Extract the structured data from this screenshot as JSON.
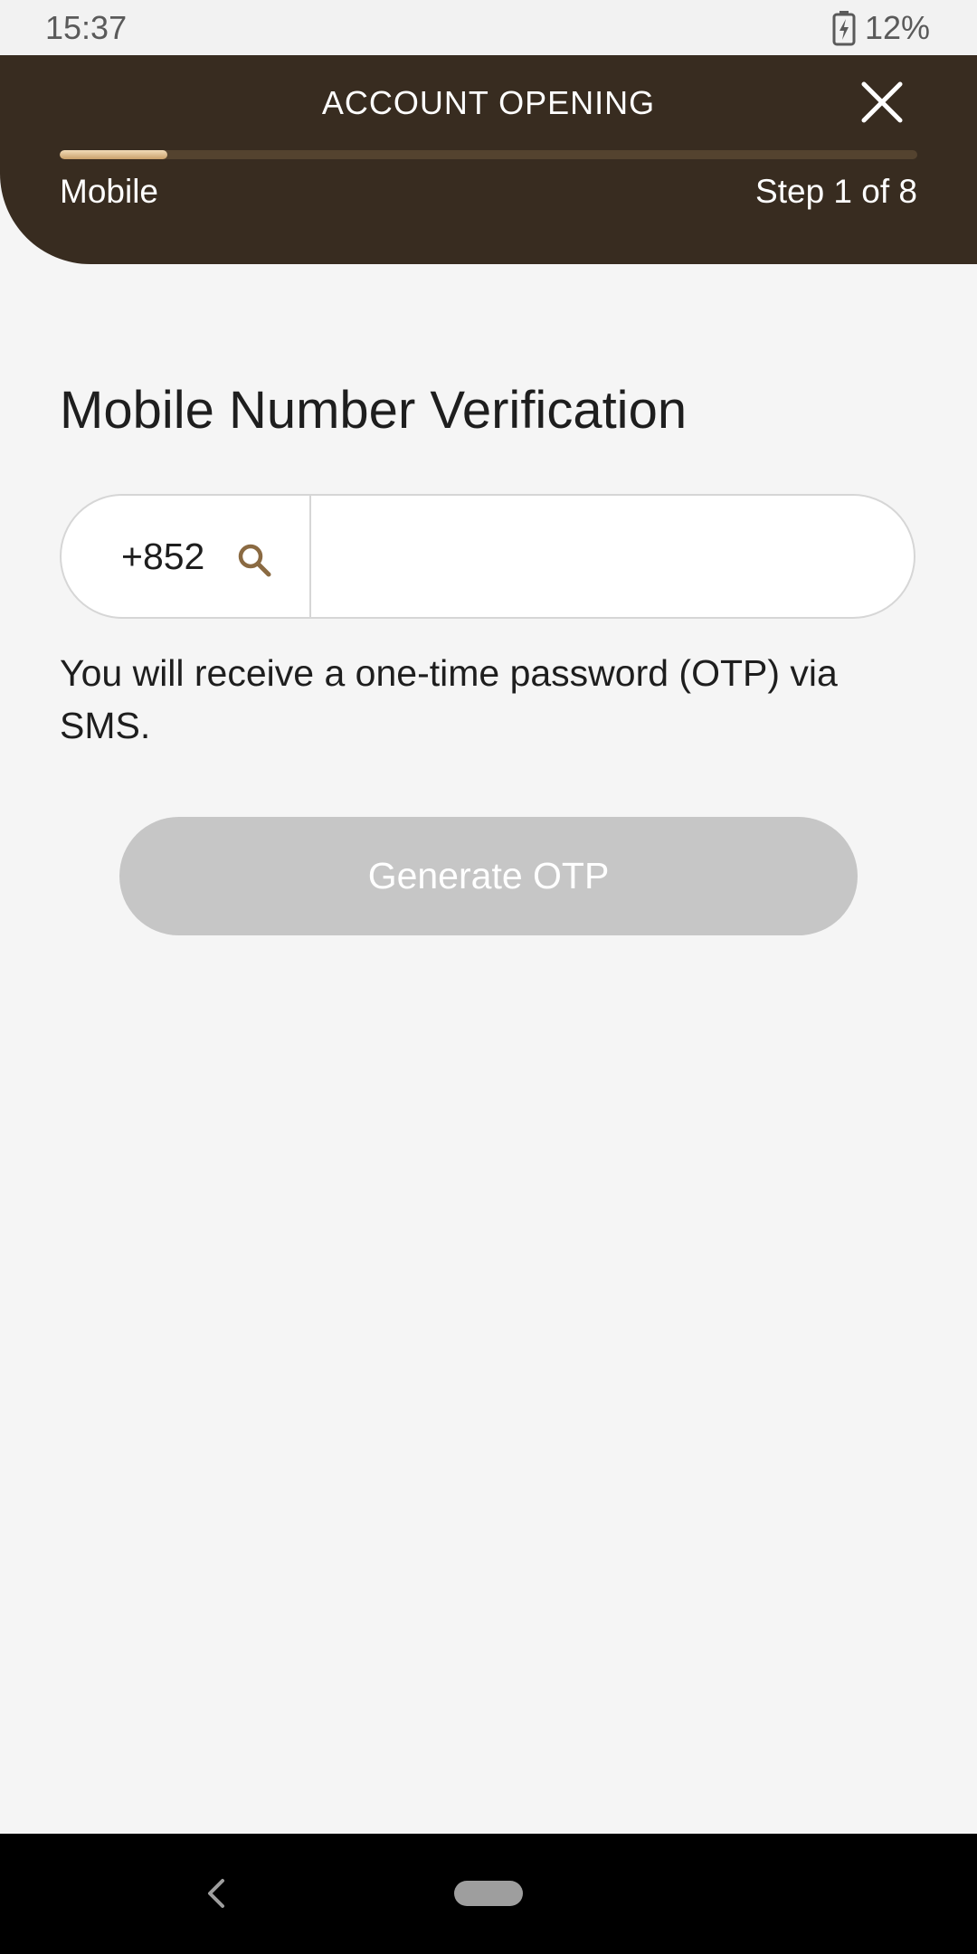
{
  "status_bar": {
    "time": "15:37",
    "battery": "12%",
    "battery_icon": "battery-charging-icon"
  },
  "header": {
    "title": "ACCOUNT OPENING",
    "close_icon": "close-icon",
    "progress_fraction": 0.125,
    "step_label": "Mobile",
    "step_count": "Step 1 of 8"
  },
  "main": {
    "title": "Mobile Number Verification",
    "country_code": "+852",
    "country_search_icon": "search-icon",
    "phone_value": "",
    "phone_placeholder": "",
    "otp_info": "You will receive a one-time password (OTP) via SMS.",
    "generate_button": "Generate OTP"
  },
  "nav_bar": {
    "back_icon": "back-chevron-icon",
    "home_icon": "home-pill-icon"
  },
  "colors": {
    "header_bg": "#382c20",
    "progress_fill": "#e8cfa6",
    "accent": "#8a6a42",
    "button_disabled": "#c6c6c6"
  }
}
